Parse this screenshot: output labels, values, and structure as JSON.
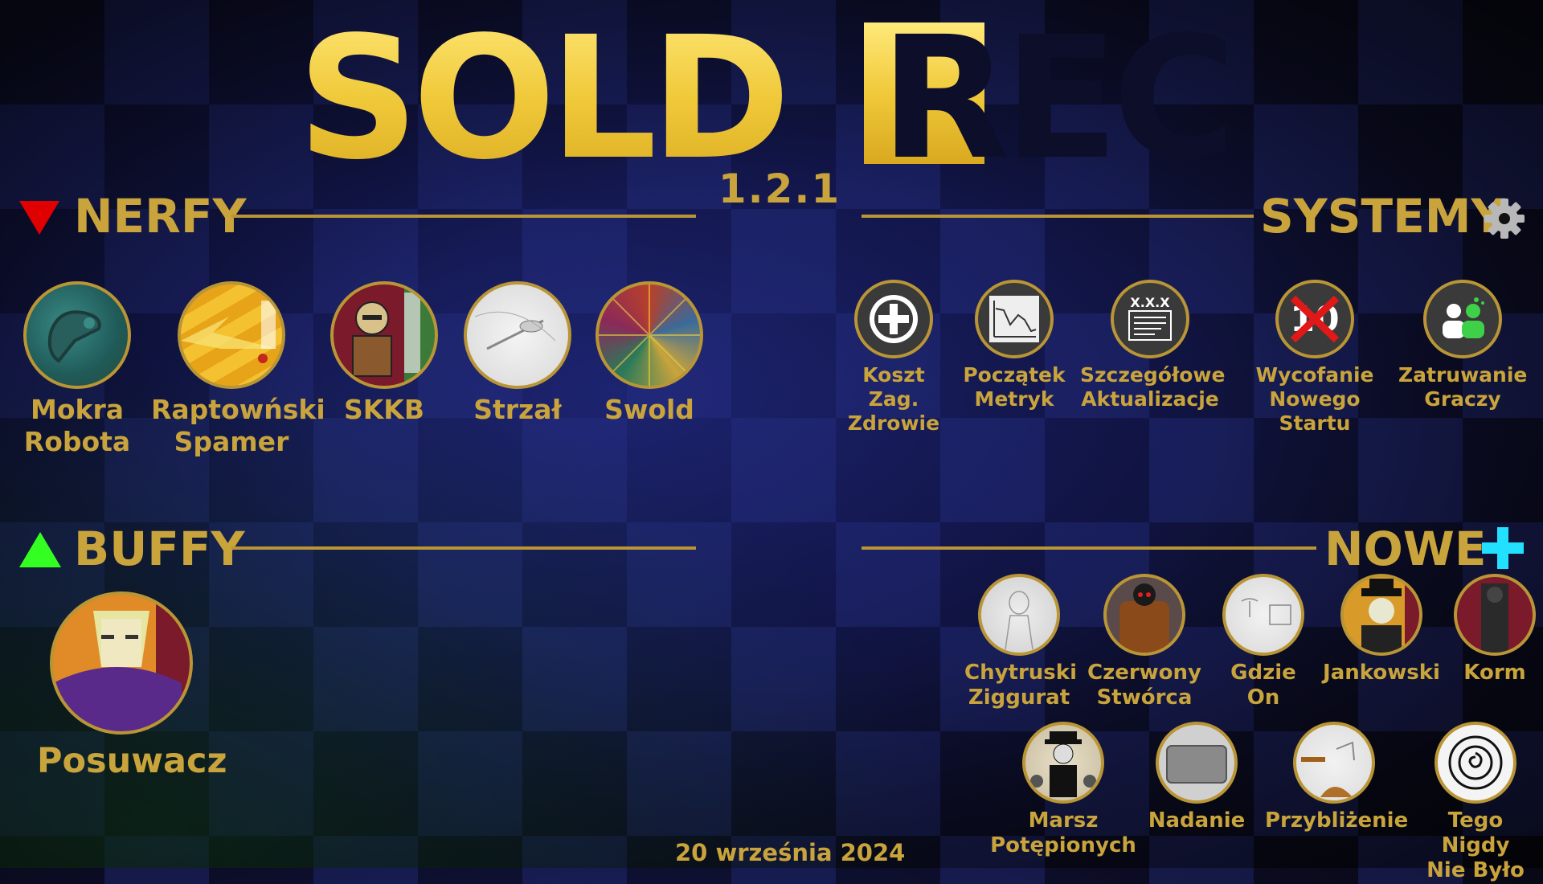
{
  "logo": {
    "part1": "SOLD",
    "part2": "REC"
  },
  "version": "1.2.1",
  "sections": {
    "nerfy": "NERFY",
    "systemy": "SYSTEMY",
    "buffy": "BUFFY",
    "nowe": "NOWE"
  },
  "nerfy_items": [
    {
      "label": "Mokra\nRobota"
    },
    {
      "label": "Raptowński\nSpamer"
    },
    {
      "label": "SKKB"
    },
    {
      "label": "Strzał"
    },
    {
      "label": "Swold"
    }
  ],
  "systemy_items": [
    {
      "label": "Koszt Zag.\nZdrowie"
    },
    {
      "label": "Początek\nMetryk"
    },
    {
      "label": "Szczegółowe\nAktualizacje",
      "icon_text": "X.X.X"
    },
    {
      "label": "Wycofanie\nNowego Startu",
      "icon_text": "10"
    },
    {
      "label": "Zatruwanie\nGraczy"
    }
  ],
  "buffy_items": [
    {
      "label": "Posuwacz"
    }
  ],
  "nowe_items": [
    {
      "label": "Chytruski\nZiggurat"
    },
    {
      "label": "Czerwony\nStwórca"
    },
    {
      "label": "Gdzie\nOn"
    },
    {
      "label": "Jankowski"
    },
    {
      "label": "Korm"
    },
    {
      "label": "Marsz\nPotępionych"
    },
    {
      "label": "Nadanie"
    },
    {
      "label": "Przybliżenie"
    },
    {
      "label": "Tego Nigdy\nNie Było"
    }
  ],
  "date": "20 września 2024",
  "colors": {
    "gold": "#c9a43c",
    "rule": "#b99535",
    "nerf": "#e00000",
    "buff": "#33ff22",
    "new": "#22e0ff"
  },
  "icons": [
    "triangle-down-icon",
    "triangle-up-icon",
    "gear-icon",
    "plus-icon",
    "cross-icon",
    "chart-icon",
    "document-icon",
    "users-icon"
  ]
}
